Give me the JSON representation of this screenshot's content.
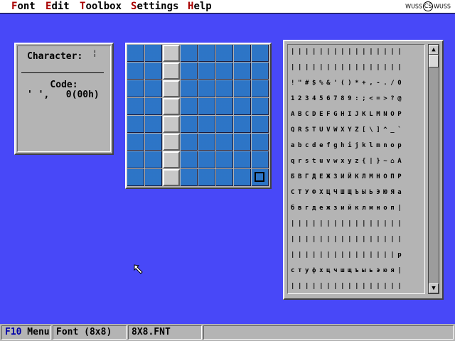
{
  "menu": {
    "items": [
      {
        "hot": "F",
        "rest": "ont"
      },
      {
        "hot": "E",
        "rest": "dit"
      },
      {
        "hot": "T",
        "rest": "oolbox"
      },
      {
        "hot": "S",
        "rest": "ettings"
      },
      {
        "hot": "H",
        "rest": "elp"
      }
    ],
    "logo_left": "WUSS",
    "logo_mark": "CS",
    "logo_right": "WUSS"
  },
  "character_panel": {
    "label": "Character:",
    "glyph": "¦",
    "code_label": "Code:",
    "code_value": "' ',   0(00h)"
  },
  "editor": {
    "cols": 8,
    "rows": 8,
    "on_column": 2,
    "selected_cell": [
      7,
      7
    ]
  },
  "charset": {
    "rows": [
      "||||||||||||||||",
      "||||||||||||||||",
      "!\"#$%&'()*+,-./0",
      "123456789:;<=>?@",
      "ABCDEFGHIJKLMNOP",
      "QRSTUVWXYZ[\\]^_`",
      "abcdefghijklmnop",
      "qrstuvwxyz{|}~⌂A",
      "БВГДЕЖЗИЙКЛМНОПР",
      "СТУФХЦЧШЩЪЫЬЭЮЯа",
      "бвгдежзийклмноп|",
      "||||||||||||||||",
      "||||||||||||||||",
      "|||||||||||||||р",
      "стуфхцчшщъыьэюя|",
      "||||||||||||||||"
    ],
    "scroll_up": "▲",
    "scroll_down": "▼"
  },
  "status": {
    "menu_key": "F10",
    "menu_label": " Menu",
    "font_info": "Font (8x8)",
    "file_name": "8X8.FNT",
    "message": ""
  }
}
